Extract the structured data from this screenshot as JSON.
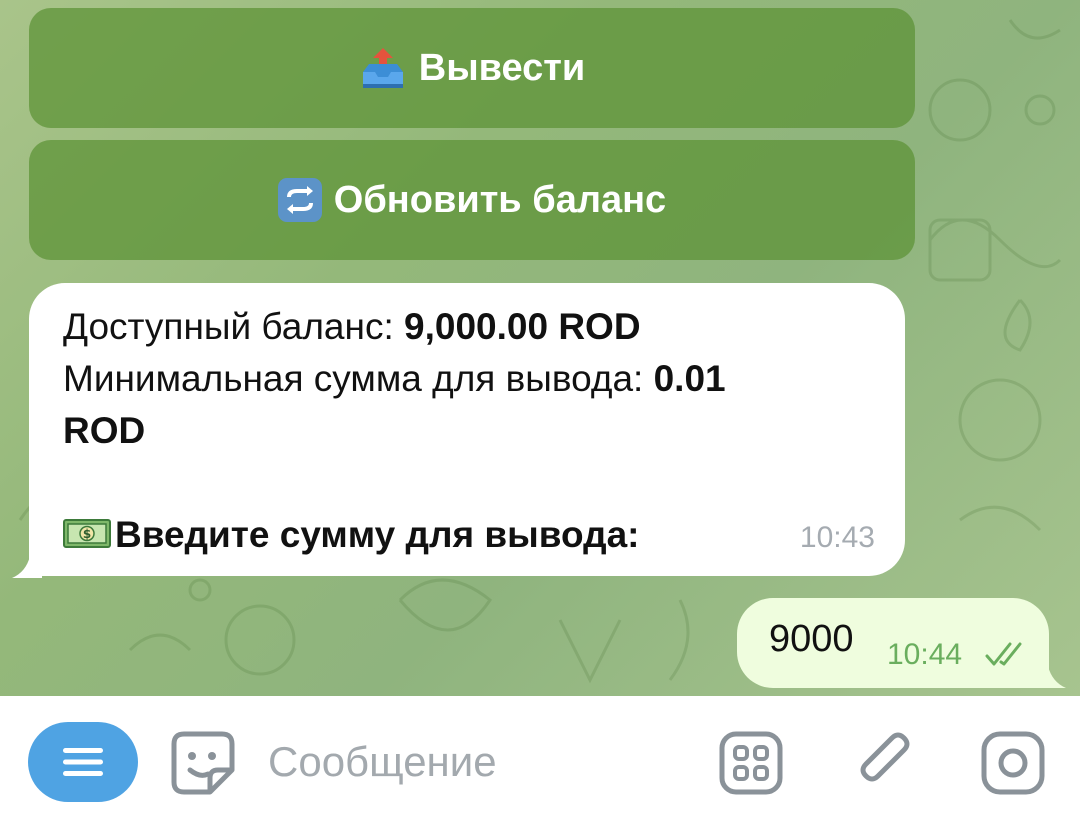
{
  "keyboard": {
    "withdraw_label": "Вывести",
    "withdraw_icon": "inbox-tray-upload-icon",
    "refresh_label": "Обновить баланс",
    "refresh_icon": "repeat-arrows-icon"
  },
  "incoming_message": {
    "balance_label": "Доступный баланс: ",
    "balance_value": "9,000.00 ROD",
    "min_label": "Минимальная сумма для вывода: ",
    "min_value_line1": "0.01",
    "min_value_line2": "ROD",
    "prompt_icon": "money-bills-icon",
    "prompt_text": "Введите сумму для вывода:",
    "time": "10:43"
  },
  "outgoing_message": {
    "text": "9000",
    "time": "10:44",
    "status_icon": "double-check-icon"
  },
  "composer": {
    "menu_icon": "menu-icon",
    "sticker_icon": "sticker-smile-icon",
    "placeholder": "Сообщение",
    "apps_icon": "apps-grid-icon",
    "attach_icon": "paperclip-icon",
    "camera_icon": "camera-circle-icon"
  },
  "colors": {
    "keyboard_button": "#5c9134",
    "outgoing_bubble": "#effdde",
    "menu_button": "#4fa3e3",
    "read_check": "#6aae5e"
  }
}
